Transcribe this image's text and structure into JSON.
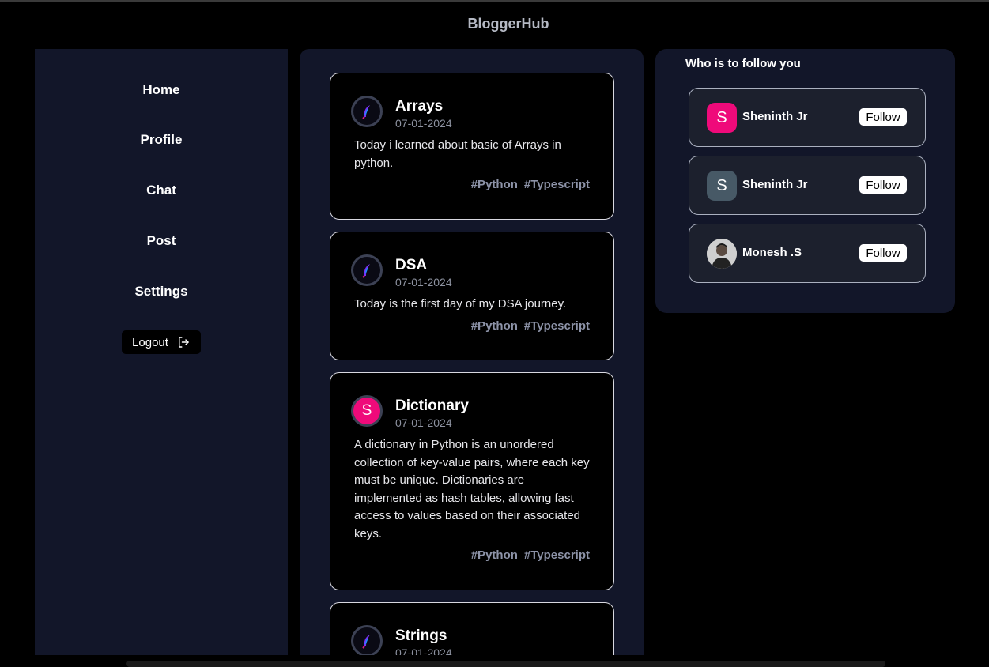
{
  "app": {
    "title": "BloggerHub"
  },
  "sidebar": {
    "items": [
      {
        "label": "Home"
      },
      {
        "label": "Profile"
      },
      {
        "label": "Chat"
      },
      {
        "label": "Post"
      },
      {
        "label": "Settings"
      }
    ],
    "logout_label": "Logout",
    "logout_icon": "logout-arrow-icon"
  },
  "posts": [
    {
      "title": "Arrays",
      "date": "07-01-2024",
      "body": "Today i learned about basic of Arrays in python.",
      "avatar": "logo",
      "tags": [
        "#Python",
        "#Typescript"
      ]
    },
    {
      "title": "DSA",
      "date": "07-01-2024",
      "body": "Today is the first day of my DSA journey.",
      "avatar": "logo",
      "tags": [
        "#Python",
        "#Typescript"
      ]
    },
    {
      "title": "Dictionary",
      "date": "07-01-2024",
      "body": "A dictionary in Python is an unordered collection of key-value pairs, where each key must be unique. Dictionaries are implemented as hash tables, allowing fast access to values based on their associated keys.",
      "avatar_letter": "S",
      "tags": [
        "#Python",
        "#Typescript"
      ]
    },
    {
      "title": "Strings",
      "date": "07-01-2024",
      "avatar": "logo"
    }
  ],
  "follow": {
    "title": "Who is to follow you",
    "button_label": "Follow",
    "users": [
      {
        "name": "Sheninth Jr",
        "initial": "S",
        "color": "#ef0a7a"
      },
      {
        "name": "Sheninth Jr",
        "initial": "S",
        "color": "#475966"
      },
      {
        "name": "Monesh .S",
        "avatar": "photo"
      }
    ]
  },
  "colors": {
    "panel": "#121629",
    "accent_pink": "#ef0a7a",
    "tag": "#8d93a8"
  }
}
